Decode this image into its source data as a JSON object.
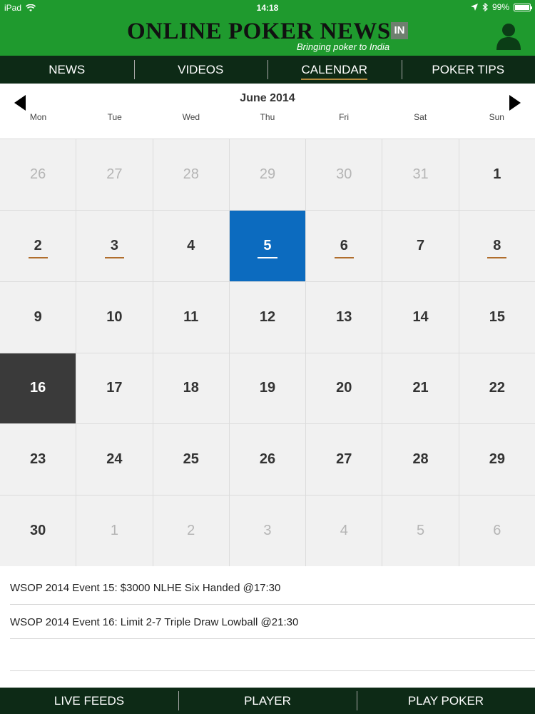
{
  "status_bar": {
    "device": "iPad",
    "time": "14:18",
    "battery": "99%",
    "battery_level": 0.99
  },
  "header": {
    "logo_text": "ONLINE POKER NEWS",
    "logo_suffix": "IN",
    "tagline": "Bringing poker to India",
    "background_color": "#1f9a2e"
  },
  "nav": {
    "items": [
      {
        "label": "NEWS",
        "active": false
      },
      {
        "label": "VIDEOS",
        "active": false
      },
      {
        "label": "CALENDAR",
        "active": true
      },
      {
        "label": "POKER TIPS",
        "active": false
      }
    ]
  },
  "calendar": {
    "month_title": "June 2014",
    "weekdays": [
      "Mon",
      "Tue",
      "Wed",
      "Thu",
      "Fri",
      "Sat",
      "Sun"
    ],
    "selected_color": "#0c6bbf",
    "today_color": "#3a3a3a",
    "event_marker_color": "#b06d2c",
    "days": [
      {
        "n": "26",
        "other": true
      },
      {
        "n": "27",
        "other": true
      },
      {
        "n": "28",
        "other": true
      },
      {
        "n": "29",
        "other": true
      },
      {
        "n": "30",
        "other": true
      },
      {
        "n": "31",
        "other": true
      },
      {
        "n": "1"
      },
      {
        "n": "2",
        "event": true
      },
      {
        "n": "3",
        "event": true
      },
      {
        "n": "4"
      },
      {
        "n": "5",
        "event": true,
        "selected": true
      },
      {
        "n": "6",
        "event": true
      },
      {
        "n": "7"
      },
      {
        "n": "8",
        "event": true
      },
      {
        "n": "9"
      },
      {
        "n": "10"
      },
      {
        "n": "11"
      },
      {
        "n": "12"
      },
      {
        "n": "13"
      },
      {
        "n": "14"
      },
      {
        "n": "15"
      },
      {
        "n": "16",
        "today": true
      },
      {
        "n": "17"
      },
      {
        "n": "18"
      },
      {
        "n": "19"
      },
      {
        "n": "20"
      },
      {
        "n": "21"
      },
      {
        "n": "22"
      },
      {
        "n": "23"
      },
      {
        "n": "24"
      },
      {
        "n": "25"
      },
      {
        "n": "26"
      },
      {
        "n": "27"
      },
      {
        "n": "28"
      },
      {
        "n": "29"
      },
      {
        "n": "30"
      },
      {
        "n": "1",
        "other": true
      },
      {
        "n": "2",
        "other": true
      },
      {
        "n": "3",
        "other": true
      },
      {
        "n": "4",
        "other": true
      },
      {
        "n": "5",
        "other": true
      },
      {
        "n": "6",
        "other": true
      }
    ]
  },
  "events": {
    "items": [
      "WSOP 2014 Event 15: $3000 NLHE Six Handed @17:30",
      "WSOP 2014 Event 16: Limit 2-7 Triple Draw Lowball  @21:30"
    ]
  },
  "bottom_nav": {
    "items": [
      "LIVE FEEDS",
      "PLAYER",
      "PLAY POKER"
    ]
  }
}
